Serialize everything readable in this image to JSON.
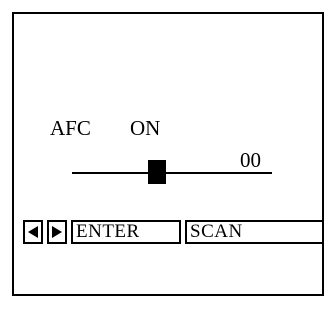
{
  "afc": {
    "label": "AFC",
    "value": "ON"
  },
  "slider": {
    "value": "00"
  },
  "controls": {
    "left_icon": "triangle-left",
    "right_icon": "triangle-right",
    "enter_label": "ENTER",
    "scan_label": "SCAN"
  }
}
